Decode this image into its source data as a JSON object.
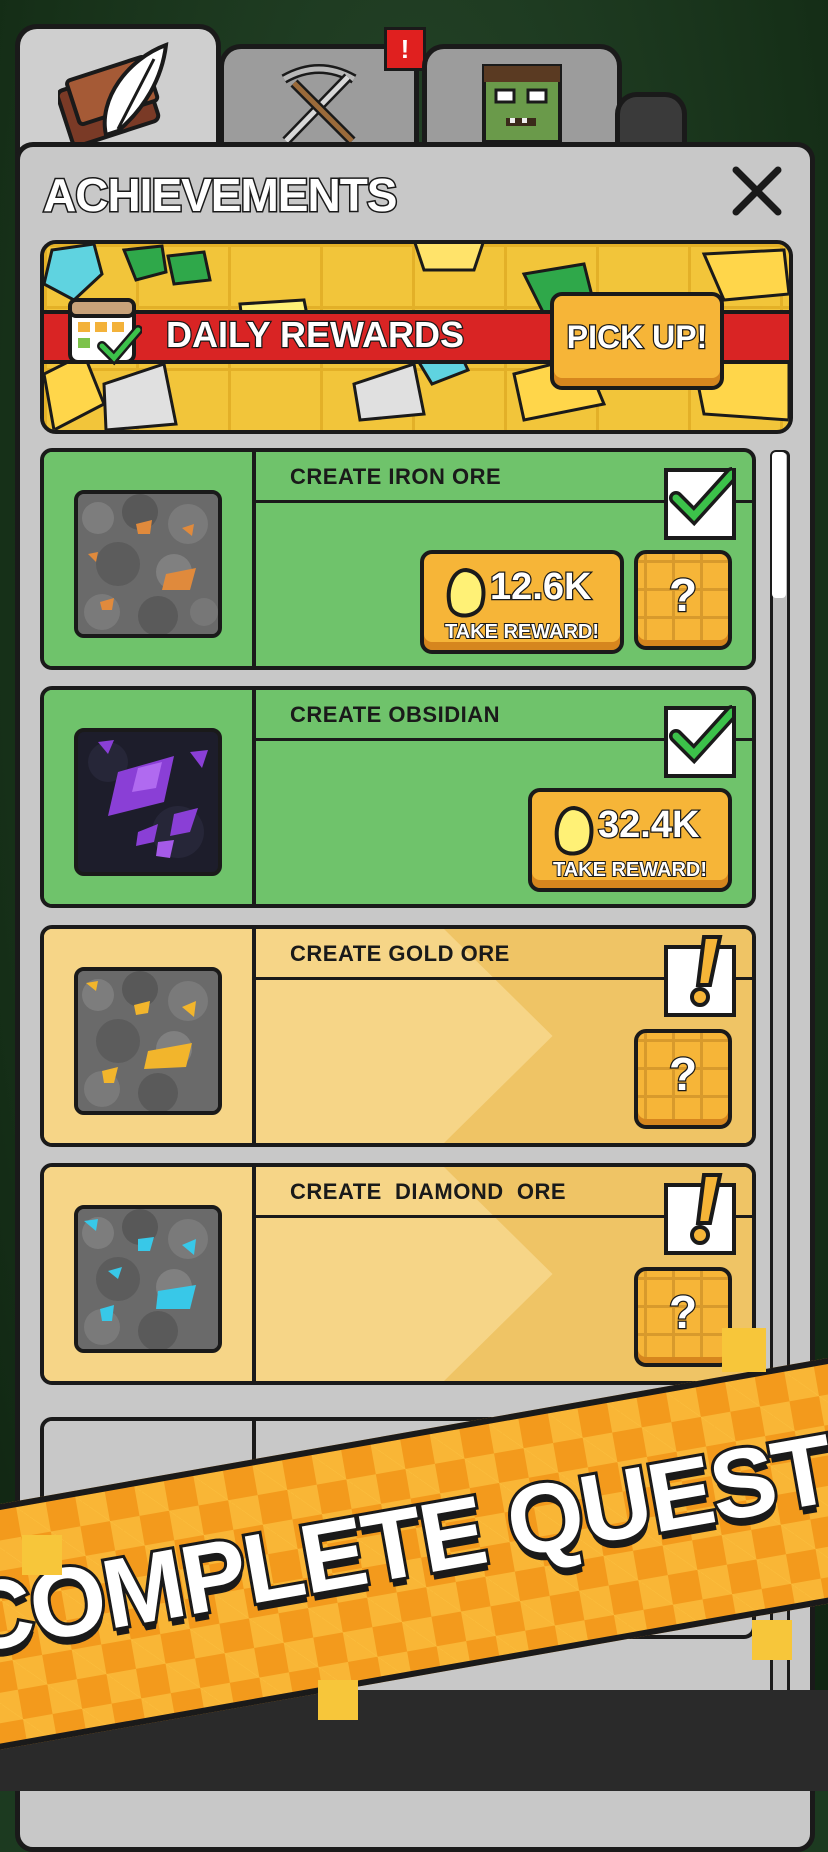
{
  "tabs": [
    {
      "name": "achievements",
      "icon": "book-quill-icon",
      "active": true
    },
    {
      "name": "battle",
      "icon": "crossed-sword-pickaxe-icon",
      "alert": "!"
    },
    {
      "name": "zombie",
      "icon": "zombie-face-icon"
    }
  ],
  "header": {
    "title": "ACHIEVEMENTS",
    "close_icon": "close-icon"
  },
  "daily": {
    "label": "DAILY REWARDS",
    "button": "PICK UP!"
  },
  "achievements": [
    {
      "name": "CREATE IRON ORE",
      "status": "done",
      "reward": "12.6K",
      "reward_label": "TAKE REWARD!",
      "help": "?",
      "ore_color": "#e08a3c"
    },
    {
      "name": "CREATE OBSIDIAN",
      "status": "done",
      "reward": "32.4K",
      "reward_label": "TAKE REWARD!",
      "ore_color": "#8a3fd6"
    },
    {
      "name": "CREATE GOLD ORE",
      "status": "pending",
      "help": "?",
      "ore_color": "#f2b52c"
    },
    {
      "name": "CREATE  DIAMOND  ORE",
      "status": "pending",
      "help": "?",
      "ore_color": "#38c8e8"
    }
  ],
  "promo": {
    "text": "COMPLETE QUESTS"
  },
  "colors": {
    "done": "#6fc36b",
    "pending": "#f6d587",
    "button": "#f6b538",
    "alert": "#e0201f"
  }
}
